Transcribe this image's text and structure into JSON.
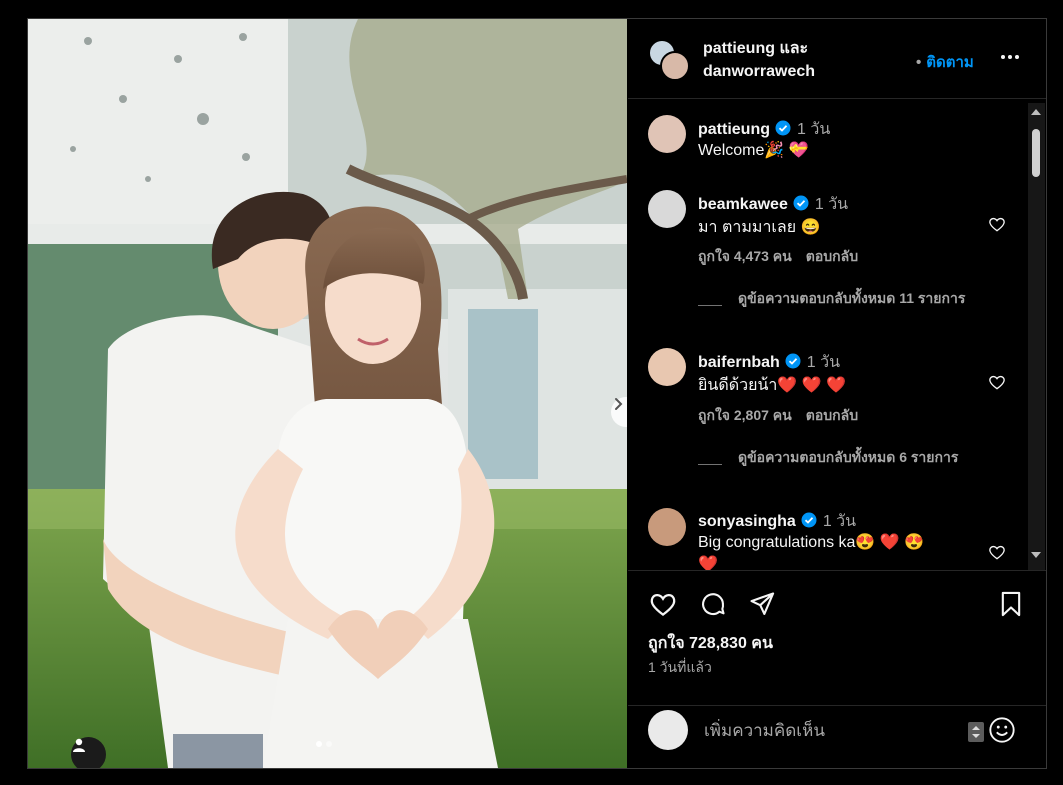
{
  "header": {
    "names": "pattieung และ",
    "names_line2": "danworrawech",
    "follow_label": "ติดตาม",
    "bullet": "•"
  },
  "comments": [
    {
      "user": "pattieung",
      "time": "1 วัน",
      "text": "Welcome🎉 💝",
      "verified": true
    },
    {
      "user": "beamkawee",
      "time": "1 วัน",
      "text": "มา ตามมาเลย 😄",
      "verified": true,
      "likes": "ถูกใจ 4,473 คน",
      "reply": "ตอบกลับ",
      "view_replies": "ดูข้อความตอบกลับทั้งหมด 11 รายการ"
    },
    {
      "user": "baifernbah",
      "time": "1 วัน",
      "text": "ยินดีด้วยน้า❤️ ❤️ ❤️",
      "verified": true,
      "likes": "ถูกใจ 2,807 คน",
      "reply": "ตอบกลับ",
      "view_replies": "ดูข้อความตอบกลับทั้งหมด 6 รายการ"
    },
    {
      "user": "sonyasingha",
      "time": "1 วัน",
      "text": "Big congratulations ka😍 ❤️ 😍",
      "text2": "❤️",
      "verified": true
    }
  ],
  "actions": {
    "likes": "ถูกใจ 728,830 คน",
    "posted_ago": "1 วันที่แล้ว"
  },
  "composer": {
    "placeholder": "เพิ่มความคิดเห็น"
  },
  "icons": {
    "like": "heart-icon",
    "comment": "comment-bubble-icon",
    "share": "paper-plane-icon",
    "save": "bookmark-icon",
    "more": "ellipsis-icon",
    "emoji": "emoji-smile-icon",
    "next": "chevron-right-icon",
    "user_tag": "person-icon",
    "verified": "verified-badge-icon"
  },
  "colors": {
    "accent": "#0095f6",
    "background": "#000000",
    "text": "#f5f5f5",
    "muted": "#a8a8a8"
  },
  "carousel": {
    "total": 2,
    "current": 1
  }
}
